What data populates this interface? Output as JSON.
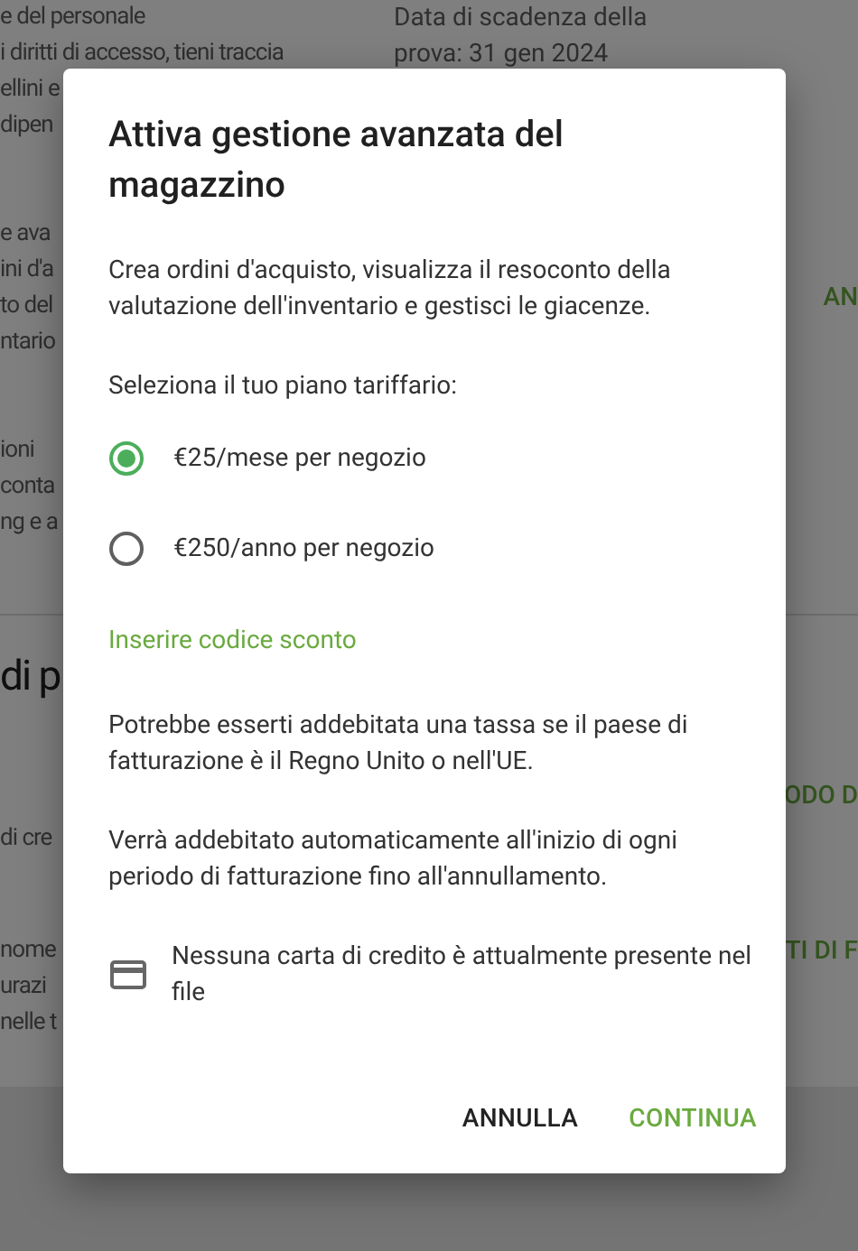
{
  "background": {
    "sections": [
      {
        "kind": "block",
        "lines": [
          "e del personale",
          "i diritti di accesso, tieni traccia",
          "ellini e",
          "dipen"
        ],
        "aside": [
          "Data di scadenza della",
          "prova: 31 gen 2024"
        ]
      },
      {
        "kind": "block",
        "lines": [
          "e ava",
          "ini d'a",
          "to del",
          "ntario"
        ],
        "action": "AN"
      },
      {
        "kind": "block",
        "lines": [
          "ioni",
          "conta",
          "ng e a"
        ]
      },
      {
        "kind": "heading",
        "text": "di p"
      },
      {
        "kind": "row",
        "lines": [
          "di cre"
        ],
        "action": "ODO D"
      },
      {
        "kind": "row",
        "lines": [
          "nome",
          "urazi",
          "nelle t"
        ],
        "action": "TI DI F"
      }
    ]
  },
  "dialog": {
    "title": "Attiva gestione avanzata del magazzino",
    "intro": "Crea ordini d'acquisto, visualizza il resoconto della valutazione dell'inventario e gestisci le giacenze.",
    "plan_label": "Seleziona il tuo piano tariffario:",
    "plans": [
      {
        "label": "€25/mese per negozio",
        "selected": true
      },
      {
        "label": "€250/anno per negozio",
        "selected": false
      }
    ],
    "discount_link": "Inserire codice sconto",
    "tax_note": "Potrebbe esserti addebitata una tassa se il paese di fatturazione è il Regno Unito o nell'UE.",
    "billing_note": "Verrà addebitato automaticamente all'inizio di ogni periodo di fatturazione fino all'annullamento.",
    "card_note": "Nessuna carta di credito è attualmente presente nel file",
    "buttons": [
      {
        "label": "ANNULLA",
        "kind": "secondary"
      },
      {
        "label": "CONTINUA",
        "kind": "primary"
      }
    ]
  }
}
